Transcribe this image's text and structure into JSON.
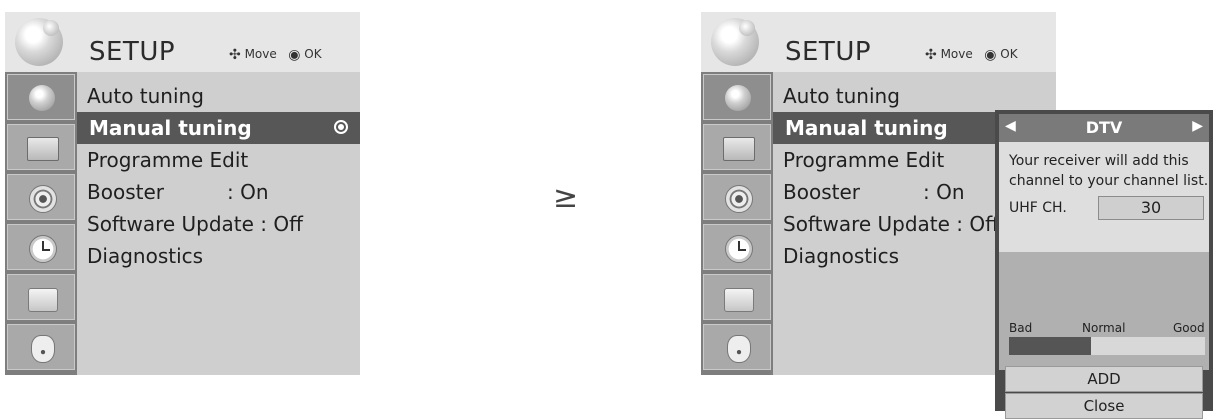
{
  "menu": {
    "title": "SETUP",
    "help_move": "Move",
    "help_ok": "OK",
    "help_move_glyph": "✣",
    "help_ok_glyph": "◉",
    "items": [
      {
        "label": "Auto tuning"
      },
      {
        "label": "Manual tuning",
        "selected": true
      },
      {
        "label": "Programme Edit"
      },
      {
        "label": "Booster",
        "value": ": On"
      },
      {
        "label": "Software Update : Off"
      },
      {
        "label": "Diagnostics"
      }
    ],
    "side_icons": [
      "satellite-dish-icon",
      "tv-picture-icon",
      "speaker-audio-icon",
      "clock-time-icon",
      "toolbox-option-icon",
      "lock-icon"
    ]
  },
  "transition_arrow": "≥",
  "popup": {
    "tab_label": "DTV",
    "left_arrow": "◀",
    "right_arrow": "▶",
    "message": "Your receiver will add this channel to your channel list.",
    "channel_label": "UHF CH.",
    "channel_value": "30",
    "signal_labels": {
      "bad": "Bad",
      "normal": "Normal",
      "good": "Good"
    },
    "signal_level_fraction": 0.42,
    "add_label": "ADD",
    "close_label": "Close"
  }
}
